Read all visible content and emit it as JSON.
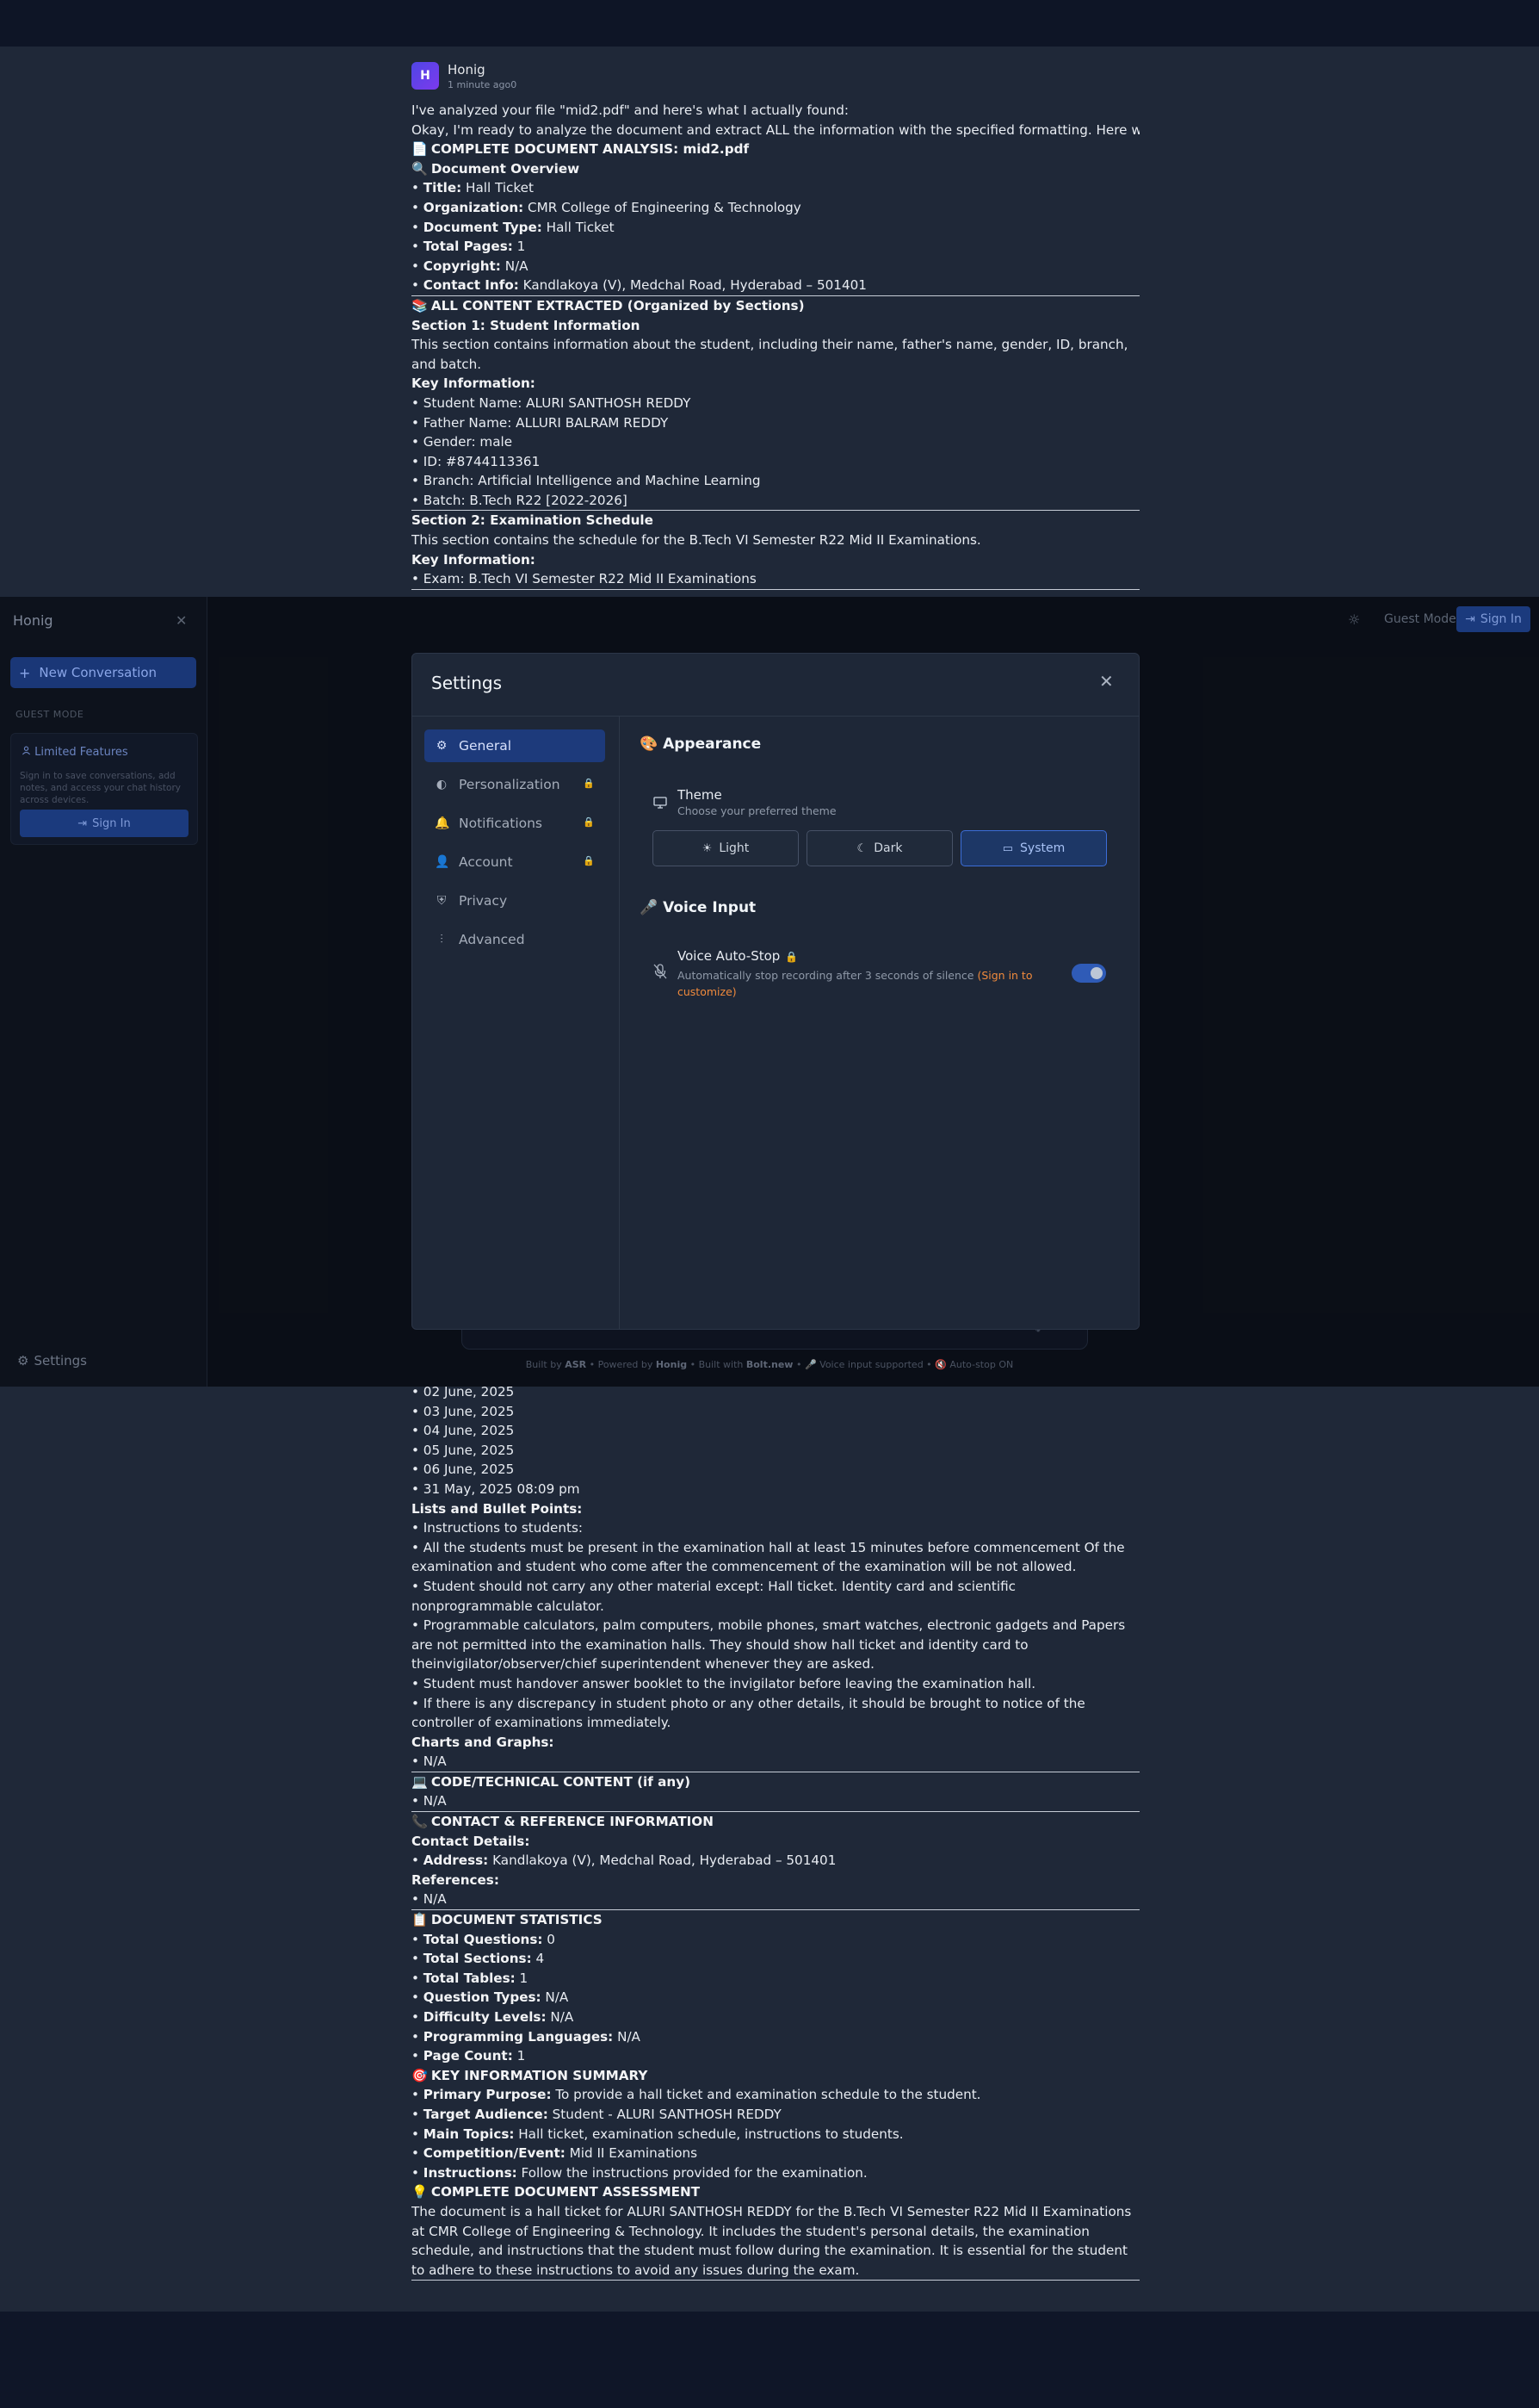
{
  "message": {
    "avatar_letter": "H",
    "author": "Honig",
    "time": "1 minute ago0"
  },
  "part1": [
    {
      "t": "I've analyzed your file \"mid2.pdf\" and here's what I actually found:"
    },
    {
      "t": "Okay, I'm ready to analyze the document and extract ALL the information with the specified formatting. Here we go!"
    },
    {
      "e": "📄",
      "b": "COMPLETE DOCUMENT ANALYSIS: mid2.pdf"
    },
    {
      "e": "🔍",
      "b": "Document Overview"
    },
    {
      "p": "• ",
      "b": "Title:",
      "t": " Hall Ticket"
    },
    {
      "p": "• ",
      "b": "Organization:",
      "t": " CMR College of Engineering & Technology"
    },
    {
      "p": "• ",
      "b": "Document Type:",
      "t": " Hall Ticket"
    },
    {
      "p": "• ",
      "b": "Total Pages:",
      "t": " 1"
    },
    {
      "p": "• ",
      "b": "Copyright:",
      "t": " N/A"
    },
    {
      "p": "• ",
      "b": "Contact Info:",
      "t": " Kandlakoya (V), Medchal Road, Hyderabad – 501401"
    },
    {
      "hr": true
    },
    {
      "e": "📚",
      "b": "ALL CONTENT EXTRACTED (Organized by Sections)"
    },
    {
      "b": "Section 1: Student Information"
    },
    {
      "t": "This section contains information about the student, including their name, father's name, gender, ID, branch, and batch.",
      "wrap": true
    },
    {
      "b": "Key Information:"
    },
    {
      "t": "• Student Name: ALURI SANTHOSH REDDY"
    },
    {
      "t": "• Father Name: ALLURI BALRAM REDDY"
    },
    {
      "t": "• Gender: male"
    },
    {
      "t": "• ID: #8744113361"
    },
    {
      "t": "• Branch: Artificial Intelligence and Machine Learning"
    },
    {
      "t": "• Batch: B.Tech R22 [2022-2026]"
    },
    {
      "hr": true
    },
    {
      "b": "Section 2: Examination Schedule"
    },
    {
      "t": "This section contains the schedule for the B.Tech VI Semester R22 Mid II Examinations."
    },
    {
      "b": "Key Information:"
    },
    {
      "t": "• Exam: B.Tech VI Semester R22 Mid II Examinations"
    },
    {
      "hr": true
    }
  ],
  "part2": [
    {
      "t": "• 02 June, 2025"
    },
    {
      "t": "• 03 June, 2025"
    },
    {
      "t": "• 04 June, 2025"
    },
    {
      "t": "• 05 June, 2025"
    },
    {
      "t": "• 06 June, 2025"
    },
    {
      "t": "• 31 May, 2025 08:09 pm"
    },
    {
      "b": "Lists and Bullet Points:"
    },
    {
      "t": "• Instructions to students:"
    },
    {
      "t": "• All the students must be present in the examination hall at least 15 minutes before commencement Of the examination and student who come after the commencement of the examination will be not allowed.",
      "wrap": true
    },
    {
      "t": "• Student should not carry any other material except: Hall ticket. Identity card and scientific nonprogrammable calculator.",
      "wrap": true
    },
    {
      "t": "• Programmable calculators, palm computers, mobile phones, smart watches, electronic gadgets and Papers are not permitted into the examination halls. They should show hall ticket and identity card to theinvigilator/observer/chief superintendent whenever they are asked.",
      "wrap": true
    },
    {
      "t": "• Student must handover answer booklet to the invigilator before leaving the examination hall."
    },
    {
      "t": "• If there is any discrepancy in student photo or any other details, it should be brought to notice of the controller of examinations immediately.",
      "wrap": true
    },
    {
      "b": "Charts and Graphs:"
    },
    {
      "t": "• N/A"
    },
    {
      "hr": true
    },
    {
      "e": "💻",
      "b": "CODE/TECHNICAL CONTENT (if any)"
    },
    {
      "t": "• N/A"
    },
    {
      "hr": true
    },
    {
      "e": "📞",
      "b": "CONTACT & REFERENCE INFORMATION"
    },
    {
      "b": "Contact Details:"
    },
    {
      "p": "• ",
      "b": "Address:",
      "t": " Kandlakoya (V), Medchal Road, Hyderabad – 501401"
    },
    {
      "b": "References:"
    },
    {
      "t": "• N/A"
    },
    {
      "hr": true
    },
    {
      "e": "📋",
      "b": "DOCUMENT STATISTICS"
    },
    {
      "p": "• ",
      "b": "Total Questions:",
      "t": " 0"
    },
    {
      "p": "• ",
      "b": "Total Sections:",
      "t": " 4"
    },
    {
      "p": "• ",
      "b": "Total Tables:",
      "t": " 1"
    },
    {
      "p": "• ",
      "b": "Question Types:",
      "t": " N/A"
    },
    {
      "p": "• ",
      "b": "Difficulty Levels:",
      "t": " N/A"
    },
    {
      "p": "• ",
      "b": "Programming Languages:",
      "t": " N/A"
    },
    {
      "p": "• ",
      "b": "Page Count:",
      "t": " 1"
    },
    {
      "e": "🎯",
      "b": "KEY INFORMATION SUMMARY"
    },
    {
      "p": "• ",
      "b": "Primary Purpose:",
      "t": " To provide a hall ticket and examination schedule to the student."
    },
    {
      "p": "• ",
      "b": "Target Audience:",
      "t": " Student - ALURI SANTHOSH REDDY"
    },
    {
      "p": "• ",
      "b": "Main Topics:",
      "t": " Hall ticket, examination schedule, instructions to students."
    },
    {
      "p": "• ",
      "b": "Competition/Event:",
      "t": " Mid II Examinations"
    },
    {
      "p": "• ",
      "b": "Instructions:",
      "t": " Follow the instructions provided for the examination."
    },
    {
      "e": "💡",
      "b": "COMPLETE DOCUMENT ASSESSMENT"
    },
    {
      "t": "The document is a hall ticket for ALURI SANTHOSH REDDY for the B.Tech VI Semester R22 Mid II Examinations at CMR College of Engineering & Technology. It includes the student's personal details, the examination schedule, and instructions that the student must follow during the examination. It is essential for the student to adhere to these instructions to avoid any issues during the exam.",
      "wrap": true
    },
    {
      "hr": true
    }
  ],
  "sidebar": {
    "title": "Honig",
    "new_conversation": "New Conversation",
    "guest_mode": "GUEST MODE",
    "limited_title": "Limited Features",
    "limited_text": "Sign in to save conversations, add notes, and access your chat history across devices.",
    "sign_in": "Sign In",
    "settings": "Settings"
  },
  "topbar": {
    "guest_mode": "Guest Mode",
    "sign_in": "Sign In"
  },
  "footer": {
    "built_by": "Built by ",
    "asr": "ASR",
    "powered": " • Powered by ",
    "honig": "Honig",
    "built_with": " • Built with ",
    "bolt": "Bolt.new",
    "voice": " • 🎤 Voice input supported • 🔇 Auto-stop ON"
  },
  "settings": {
    "title": "Settings",
    "nav": [
      {
        "label": "General",
        "icon": "gear-icon",
        "active": true,
        "locked": false
      },
      {
        "label": "Personalization",
        "icon": "palette-icon",
        "active": false,
        "locked": true
      },
      {
        "label": "Notifications",
        "icon": "bell-icon",
        "active": false,
        "locked": true
      },
      {
        "label": "Account",
        "icon": "user-icon",
        "active": false,
        "locked": true
      },
      {
        "label": "Privacy",
        "icon": "shield-icon",
        "active": false,
        "locked": false
      },
      {
        "label": "Advanced",
        "icon": "sliders-icon",
        "active": false,
        "locked": false
      }
    ],
    "appearance_title": "Appearance",
    "appearance_emoji": "🎨",
    "theme_label": "Theme",
    "theme_desc": "Choose your preferred theme",
    "theme_options": [
      {
        "label": "Light",
        "icon": "sun-icon",
        "selected": false
      },
      {
        "label": "Dark",
        "icon": "moon-icon",
        "selected": false
      },
      {
        "label": "System",
        "icon": "monitor-icon",
        "selected": true
      }
    ],
    "voice_title": "Voice Input",
    "voice_emoji": "🎤",
    "voice_autostop_label": "Voice Auto-Stop",
    "voice_autostop_desc": "Automatically stop recording after 3 seconds of silence ",
    "voice_autostop_link": "(Sign in to customize)",
    "voice_autostop_on": true
  },
  "colors": {
    "accent": "#1d3a7b",
    "orange_link": "#f08a3c",
    "toggle_on": "#2f5bb7"
  }
}
